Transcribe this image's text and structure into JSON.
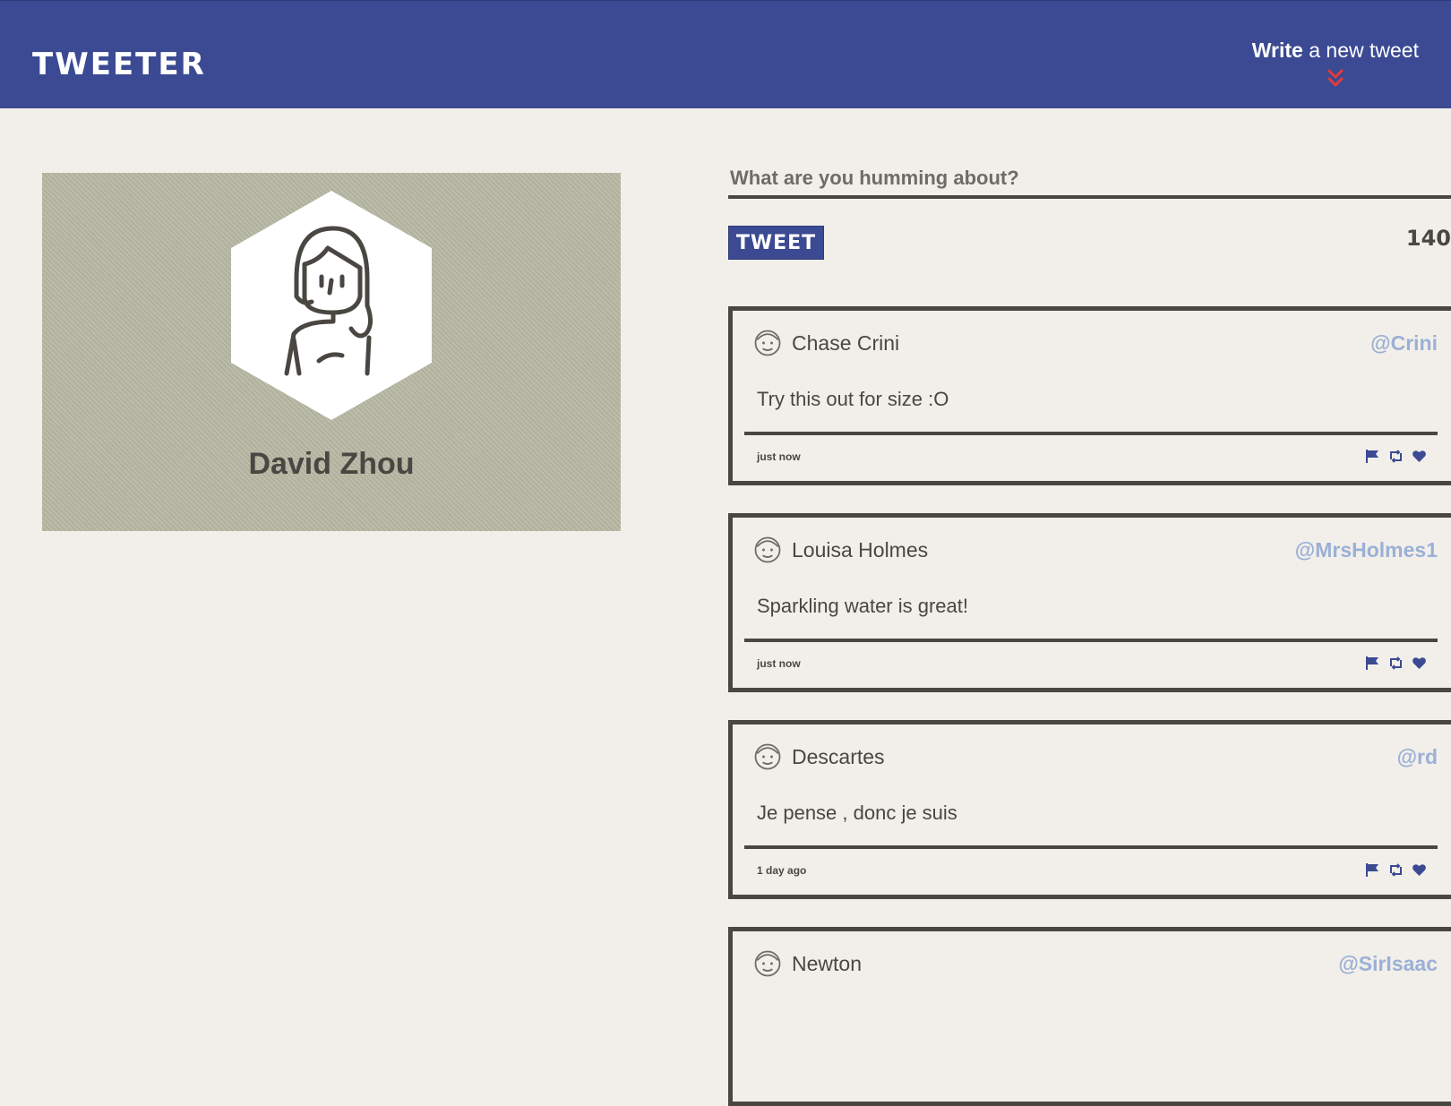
{
  "nav": {
    "brand": "TWEETER",
    "compose_bold": "Write",
    "compose_rest": " a new tweet",
    "colors": {
      "bar": "#3b4a93",
      "chevron": "#e23b3b"
    }
  },
  "profile": {
    "name": "David Zhou",
    "avatar_icon": "woman-avatar-icon"
  },
  "composer": {
    "prompt": "What are you humming about?",
    "placeholder": "",
    "button_label": "TWEET",
    "counter": "140"
  },
  "tweets": [
    {
      "author": "Chase Crini",
      "handle": "@Crini",
      "text": "Try this out for size :O",
      "time": "just now",
      "avatar_icon": "bearded-man-avatar-icon"
    },
    {
      "author": "Louisa Holmes",
      "handle": "@MrsHolmes1",
      "text": "Sparkling water is great!",
      "time": "just now",
      "avatar_icon": "woman-avatar-icon"
    },
    {
      "author": "Descartes",
      "handle": "@rd",
      "text": "Je pense , donc je suis",
      "time": "1 day ago",
      "avatar_icon": "man-avatar-icon"
    },
    {
      "author": "Newton",
      "handle": "@SirIsaac",
      "text": "",
      "time": "",
      "avatar_icon": "man-avatar-icon"
    }
  ],
  "actions": {
    "flag_icon": "flag-icon",
    "retweet_icon": "retweet-icon",
    "like_icon": "heart-icon",
    "color": "#3b4a93"
  },
  "colors": {
    "page_bg": "#f2efea",
    "ink": "#4a4742",
    "handle": "#9bb0d6"
  }
}
